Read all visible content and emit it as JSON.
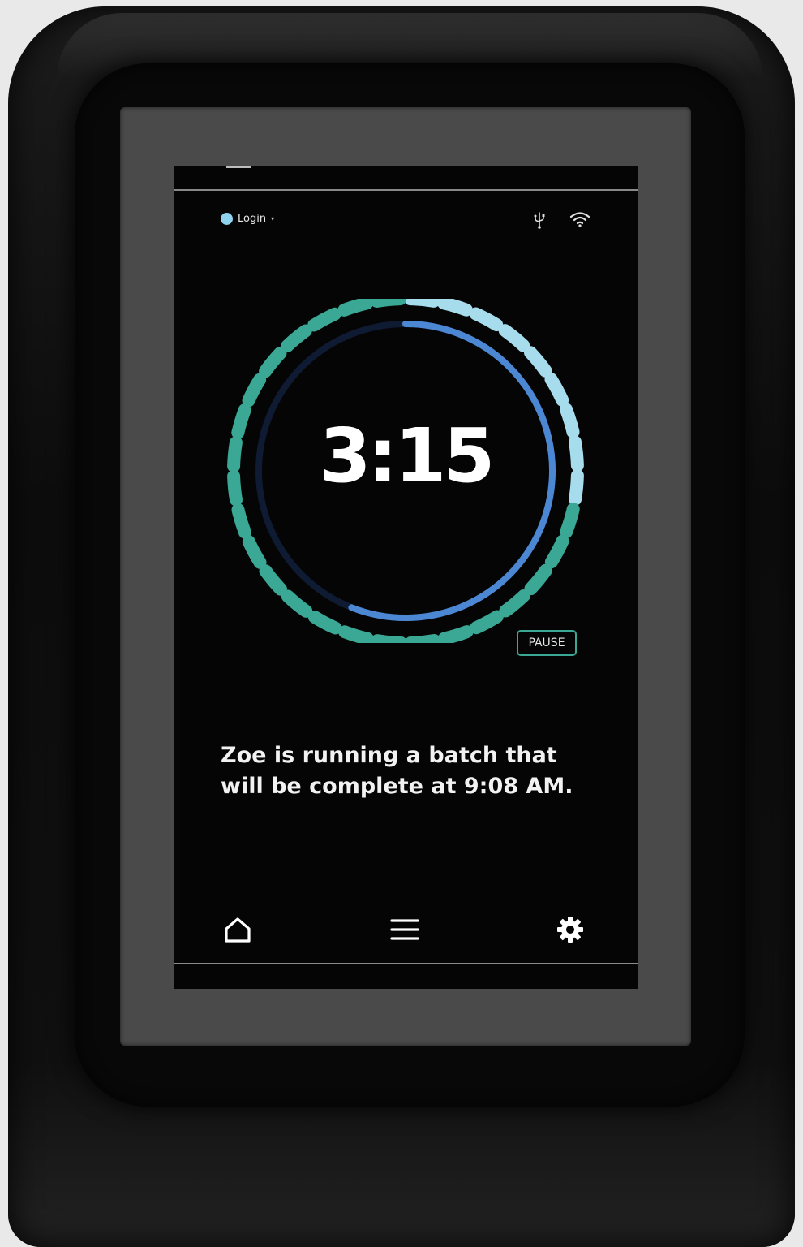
{
  "statusbar": {
    "login_label": "Login",
    "login_caret": "▾",
    "icons": [
      "usb-icon",
      "wifi-icon"
    ]
  },
  "timer": {
    "time_remaining": "3:15",
    "progress_fraction": 0.73,
    "colors": {
      "dash_done": "#3aa894",
      "dash_pending": "#a6dcec",
      "ring_track": "#0f1a33",
      "ring_progress": "#4c87d4"
    }
  },
  "pause_button": {
    "label": "PAUSE",
    "border_color": "#3aa894"
  },
  "message": {
    "line1": "Zoe is running a batch that",
    "line2": "will be complete at 9:08 AM."
  },
  "nav": {
    "items": [
      "home-icon",
      "menu-icon",
      "settings-icon"
    ]
  }
}
